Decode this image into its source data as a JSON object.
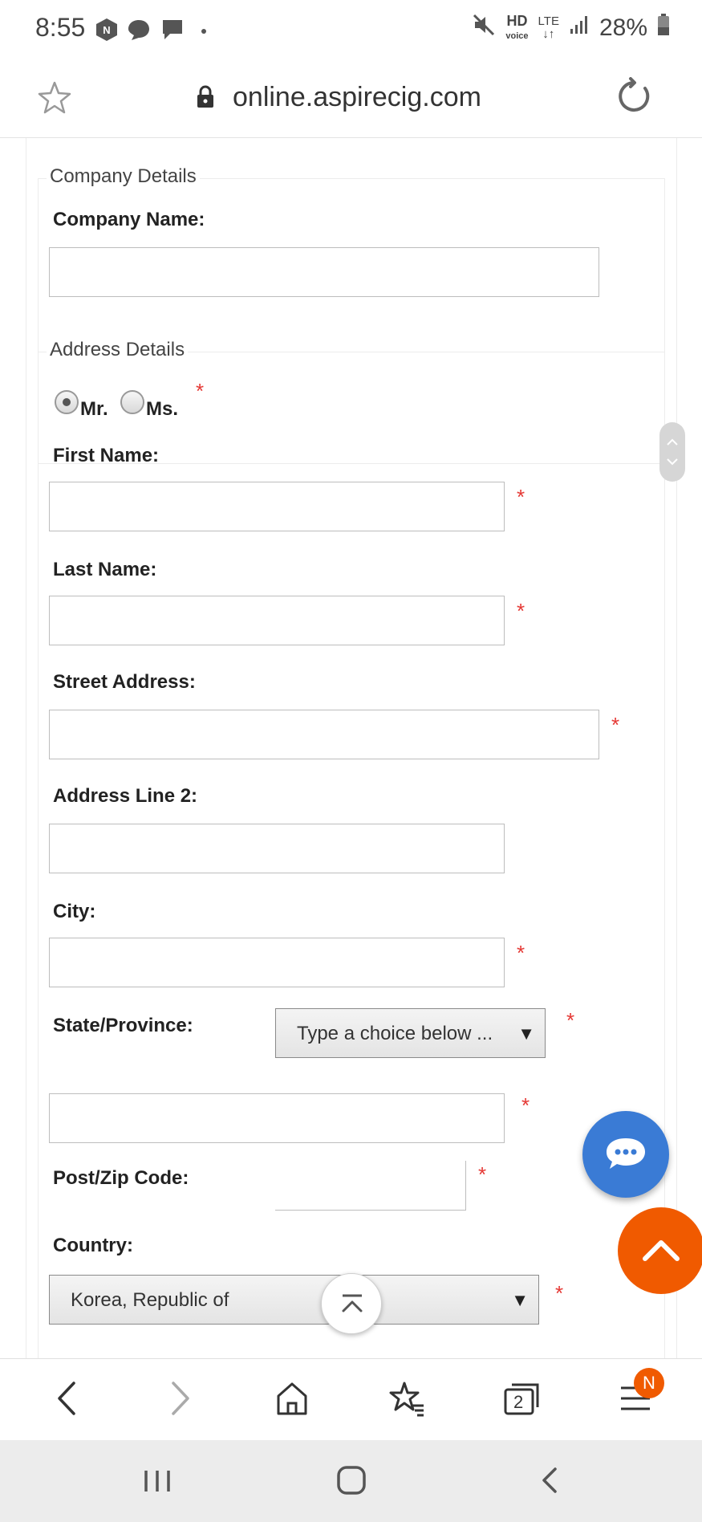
{
  "status_bar": {
    "time": "8:55",
    "network": "HD",
    "lte": "LTE",
    "battery": "28%"
  },
  "browser": {
    "url": "online.aspirecig.com"
  },
  "form": {
    "company_section": {
      "legend": "Company Details",
      "company_name_label": "Company Name:",
      "company_name_value": ""
    },
    "address_section": {
      "legend": "Address Details",
      "title_options": [
        "Mr.",
        "Ms."
      ],
      "selected_title": "Mr.",
      "required_mark": "*",
      "first_name_label": "First Name:",
      "last_name_label": "Last Name:",
      "street_label": "Street Address:",
      "address2_label": "Address Line 2:",
      "city_label": "City:",
      "state_label": "State/Province:",
      "state_select": "Type a choice below ...",
      "postcode_label": "Post/Zip Code:",
      "country_label": "Country:",
      "country_select": "Korea, Republic of"
    }
  },
  "toolbar": {
    "tabs_count": "2",
    "menu_badge": "N"
  }
}
